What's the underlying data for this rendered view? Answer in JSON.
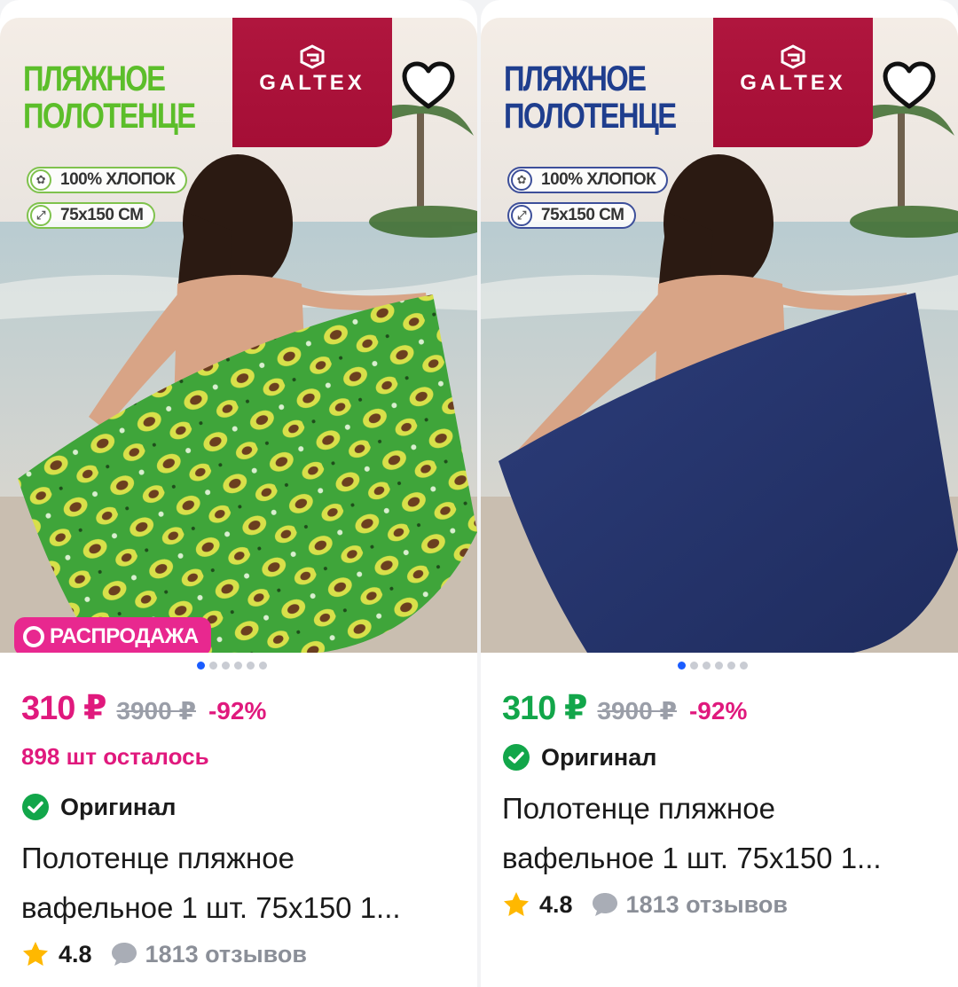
{
  "cards": [
    {
      "promo_title": "ПЛЯЖНОЕ\nПОЛОТЕНЦЕ",
      "brand": "GALTEX",
      "features": [
        "100% ХЛОПОК",
        "75x150 СМ"
      ],
      "sale_badge": "РАСПРОДАЖА",
      "towel_color": "#3fa53a",
      "carousel": {
        "total": 6,
        "active": 1
      },
      "price": "310 ₽",
      "old_price": "3900 ₽",
      "discount": "-92%",
      "stock": "898 шт осталось",
      "original": "Оригинал",
      "title": "Полотенце пляжное\nвафельное 1 шт. 75х150 1...",
      "rating": "4.8",
      "reviews": "1813 отзывов"
    },
    {
      "promo_title": "ПЛЯЖНОЕ\nПОЛОТЕНЦЕ",
      "brand": "GALTEX",
      "features": [
        "100% ХЛОПОК",
        "75x150 СМ"
      ],
      "towel_color": "#26356d",
      "carousel": {
        "total": 6,
        "active": 1
      },
      "price": "310 ₽",
      "old_price": "3900 ₽",
      "discount": "-92%",
      "original": "Оригинал",
      "title": "Полотенце пляжное\nвафельное 1 шт. 75х150 1...",
      "rating": "4.8",
      "reviews": "1813 отзывов"
    }
  ],
  "colors": {
    "sale_pink": "#e0197d",
    "price_green": "#12a64a",
    "brand_red": "#a50e36",
    "dot_active": "#1a5cff"
  },
  "icons": [
    "heart-outline-icon",
    "check-circle-icon",
    "star-icon",
    "comment-bubble-icon",
    "cotton-icon",
    "resize-arrows-icon"
  ]
}
